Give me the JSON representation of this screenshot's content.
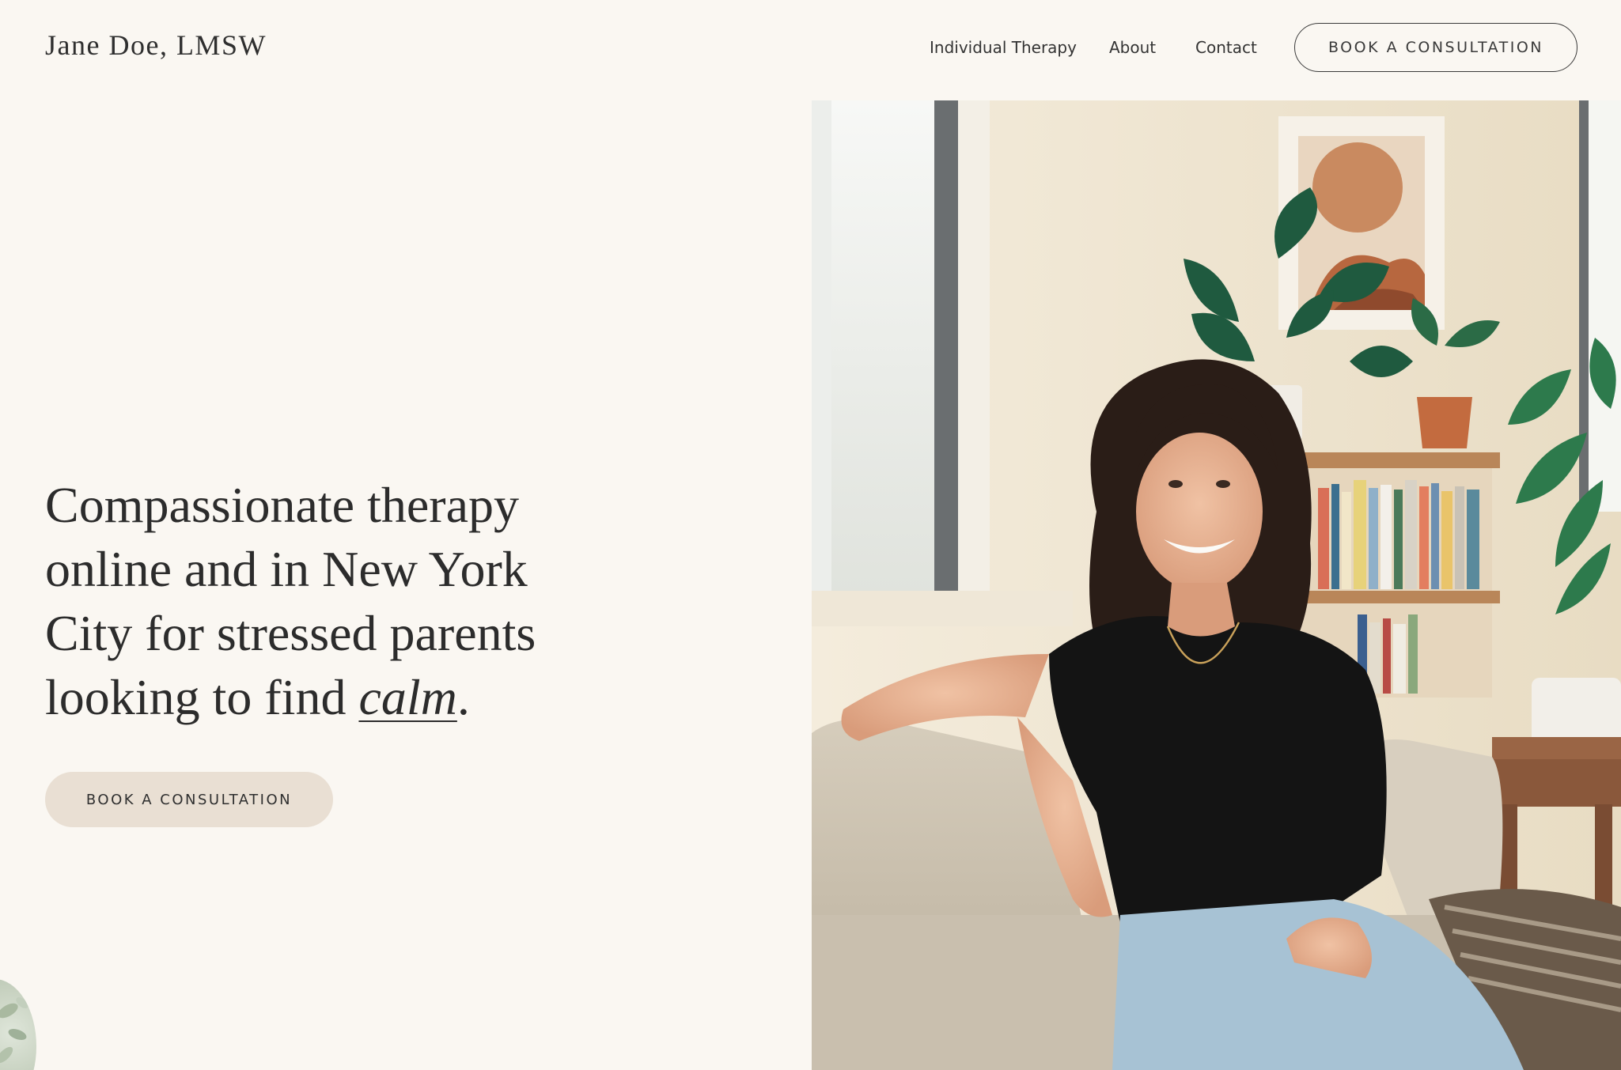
{
  "header": {
    "logo": "Jane Doe, LMSW",
    "nav": {
      "individual_therapy": "Individual Therapy",
      "about": "About",
      "contact": "Contact"
    },
    "cta_label": "BOOK A CONSULTATION"
  },
  "hero": {
    "heading_before": "Compassionate therapy online and in New York City for stressed parents looking to find ",
    "heading_accent": "calm",
    "heading_after": ".",
    "cta_label": "BOOK A CONSULTATION"
  },
  "colors": {
    "background": "#faf7f2",
    "button_fill": "#e9dfd3",
    "text": "#2c2c2c"
  },
  "icons": {
    "corner_decoration": "plant-leaves-icon"
  }
}
